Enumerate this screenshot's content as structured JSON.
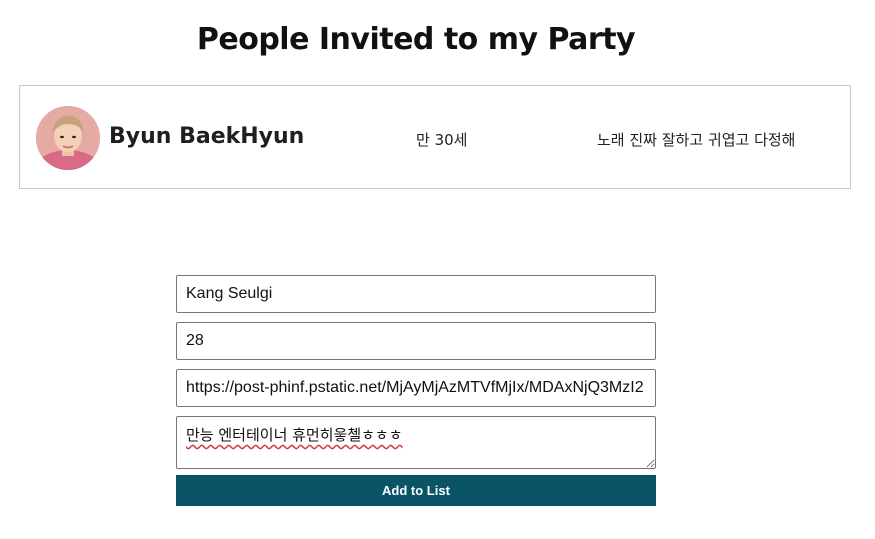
{
  "page": {
    "title": "People Invited to my Party"
  },
  "guests": [
    {
      "name": "Byun BaekHyun",
      "age": "만 30세",
      "note": "노래 진짜 잘하고 귀엽고 다정해",
      "avatar": "avatar-photo"
    }
  ],
  "form": {
    "name_value": "Kang Seulgi",
    "age_value": "28",
    "image_url_value": "https://post-phinf.pstatic.net/MjAyMjAzMTVfMjIx/MDAxNjQ3MzI2",
    "note_value": "만능 엔터테이너 휴먼히읗첼ㅎㅎㅎ",
    "submit_label": "Add to List"
  },
  "colors": {
    "button_bg": "#0b5466",
    "button_text": "#ffffff",
    "list_border": "#c8c8c8",
    "spellcheck_underline": "#d23a3a"
  }
}
